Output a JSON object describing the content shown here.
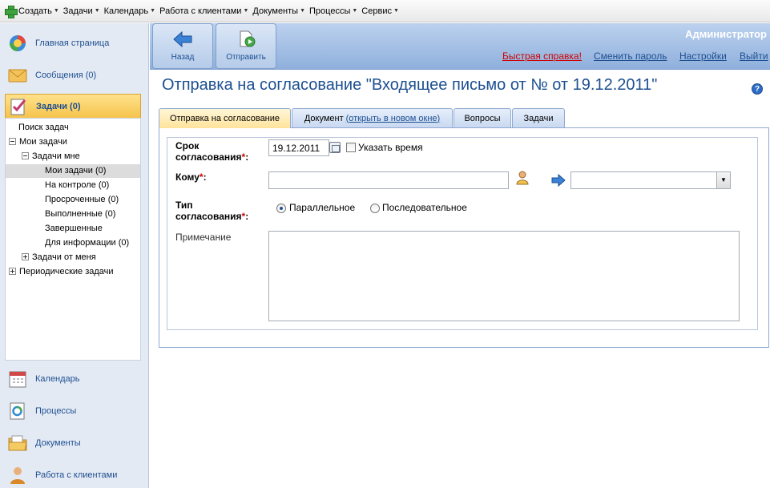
{
  "menu": {
    "items": [
      {
        "label": "Создать",
        "icon": "plus-icon"
      },
      {
        "label": "Задачи"
      },
      {
        "label": "Календарь"
      },
      {
        "label": "Работа с клиентами"
      },
      {
        "label": "Документы"
      },
      {
        "label": "Процессы"
      },
      {
        "label": "Сервис"
      }
    ]
  },
  "sidebar": {
    "nav": [
      {
        "label": "Главная страница",
        "icon": "home-icon",
        "color": "#3a8ad6"
      },
      {
        "label": "Сообщения (0)",
        "icon": "envelope-icon",
        "color": "#f0b23b"
      },
      {
        "label": "Задачи (0)",
        "icon": "task-clipboard-icon",
        "color": "#c23b6f"
      },
      {
        "label": "Календарь",
        "icon": "calendar-icon",
        "color": "#d04848"
      },
      {
        "label": "Процессы",
        "icon": "process-icon",
        "color": "#2f8bd1"
      },
      {
        "label": "Документы",
        "icon": "folder-icon",
        "color": "#e8b54a"
      },
      {
        "label": "Работа с клиентами",
        "icon": "clients-icon",
        "color": "#d88a2b"
      }
    ],
    "tree": [
      "Поиск задач",
      "Мои задачи",
      "Задачи мне",
      "Мои задачи (0)",
      "На контроле (0)",
      "Просроченные (0)",
      "Выполненные (0)",
      "Завершенные",
      "Для информации (0)",
      "Задачи от меня",
      "Периодические задачи"
    ]
  },
  "toolbar": {
    "back_label": "Назад",
    "send_label": "Отправить",
    "user": "Администратор",
    "links": {
      "help": "Быстрая справка!",
      "change_password": "Сменить пароль",
      "settings": "Настройки",
      "logout": "Выйти"
    }
  },
  "page": {
    "title": "Отправка на согласование \"Входящее письмо от № от 19.12.2011\"",
    "help_glyph": "?"
  },
  "tabs": {
    "approval": "Отправка на согласование",
    "document": "Документ",
    "document_link": "(открыть в новом окне)",
    "questions": "Вопросы",
    "tasks": "Задачи"
  },
  "form": {
    "deadline_label_1": "Срок",
    "deadline_label_2": "согласования",
    "deadline_value": "19.12.2011",
    "show_time_label": "Указать время",
    "to_label": "Кому",
    "to_value": "",
    "type_label_1": "Тип",
    "type_label_2": "согласования",
    "type_options": [
      "Параллельное",
      "Последовательное"
    ],
    "type_selected": "Параллельное",
    "note_label": "Примечание",
    "note_value": "",
    "required_mark": "*",
    "colon": ":"
  }
}
